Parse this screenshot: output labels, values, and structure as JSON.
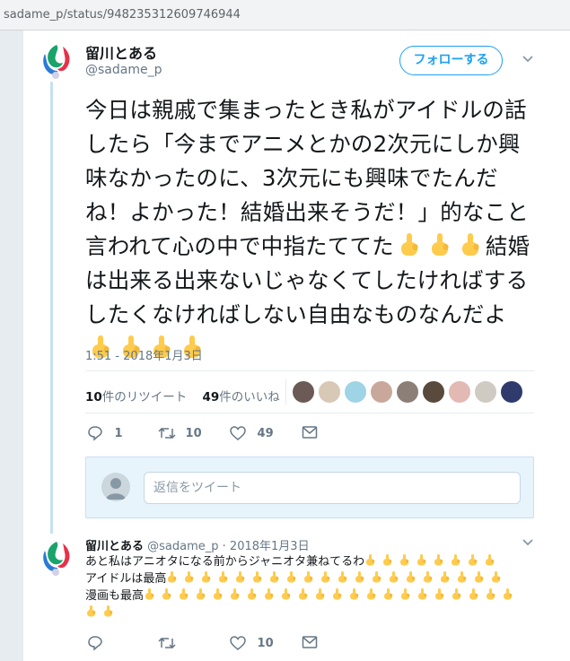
{
  "browser": {
    "url": "sadame_p/status/948235312609746944"
  },
  "colors": {
    "accent": "#1da1f2",
    "thread_line": "#c4e1f3",
    "muted": "#657786",
    "emoji_yellow": "#ffcb4c"
  },
  "tweet": {
    "author_name": "留川とある",
    "author_handle": "@sadame_p",
    "follow_label": "フォローする",
    "text_before_fingers": "今日は親戚で集まったとき私がアイドルの話したら「今までアニメとかの2次元にしか興味なかったのに、3次元にも興味でたんだね！よかった！結婚出来そうだ！」的なこと言われて心の中で中指たててた",
    "text_after_fingers": "結婚は出来る出来ないじゃなくてしたければするしたくなければしない自由なものなんだよ",
    "emoji_name": "middle-finger-emoji",
    "timestamp": "1:51 - 2018年1月3日",
    "retweet_count": "10",
    "retweet_label": "件のリツイート",
    "like_count": "49",
    "like_label": "件のいいね",
    "reply_count": "1",
    "retweet_action_count": "10",
    "like_action_count": "49"
  },
  "reply_box": {
    "placeholder": "返信をツイート"
  },
  "reply": {
    "author_name": "留川とある",
    "author_handle": "@sadame_p",
    "date": "· 2018年1月3日",
    "line1": "あと私はアニオタになる前からジャニオタ兼ねてるわ",
    "line2": "アイドルは最高",
    "line3": "漫画も最高",
    "like_count": "10"
  }
}
